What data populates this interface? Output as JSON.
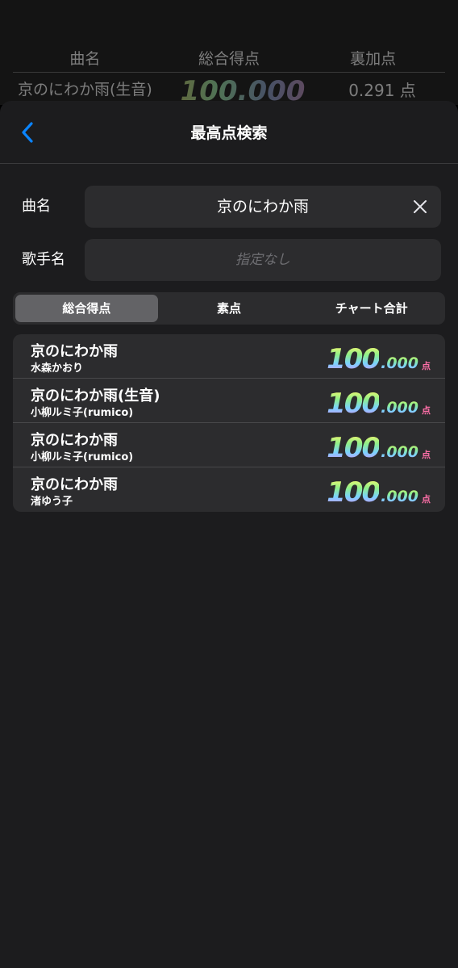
{
  "background_table": {
    "headers": [
      "曲名",
      "総合得点",
      "裏加点"
    ],
    "row": {
      "song": "京のにわか雨(生音)",
      "score": "100.000",
      "score_unit": "点",
      "extra": "0.291 点"
    }
  },
  "nav": {
    "title": "最高点検索",
    "back_icon": "chevron-left-icon"
  },
  "search": {
    "song_label": "曲名",
    "song_value": "京のにわか雨",
    "artist_label": "歌手名",
    "artist_placeholder": "指定なし"
  },
  "segments": {
    "items": [
      "総合得点",
      "素点",
      "チャート合計"
    ],
    "selected": "総合得点"
  },
  "results": [
    {
      "song": "京のにわか雨",
      "artist": "水森かおり",
      "score_int": "100",
      "score_dec": ".000",
      "unit": "点"
    },
    {
      "song": "京のにわか雨(生音)",
      "artist": "小柳ルミ子(rumico)",
      "score_int": "100",
      "score_dec": ".000",
      "unit": "点"
    },
    {
      "song": "京のにわか雨",
      "artist": "小柳ルミ子(rumico)",
      "score_int": "100",
      "score_dec": ".000",
      "unit": "点"
    },
    {
      "song": "京のにわか雨",
      "artist": "渚ゆう子",
      "score_int": "100",
      "score_dec": ".000",
      "unit": "点"
    }
  ],
  "colors": {
    "accent": "#0a84ff",
    "sheet": "#1c1c1e",
    "field": "#2c2c2e",
    "segment_active": "#636366",
    "unit": "#ff6fa8"
  }
}
